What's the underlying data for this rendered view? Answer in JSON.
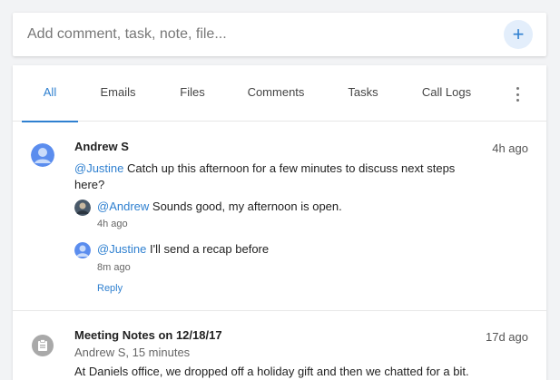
{
  "composer": {
    "placeholder": "Add comment, task, note, file...",
    "add_label": "+"
  },
  "tabs": [
    {
      "label": "All",
      "active": true
    },
    {
      "label": "Emails"
    },
    {
      "label": "Files"
    },
    {
      "label": "Comments"
    },
    {
      "label": "Tasks"
    },
    {
      "label": "Call Logs"
    }
  ],
  "colors": {
    "accent": "#2f80d0",
    "avatar": "#5b8dee",
    "note_icon": "#a9a9a9"
  },
  "feed": {
    "comment": {
      "author": "Andrew S",
      "time": "4h ago",
      "mention": "@Justine",
      "text_line1": " Catch up this afternoon for a few minutes to discuss next steps",
      "text_line2": "here?",
      "replies": [
        {
          "mention": "@Andrew",
          "text": " Sounds good, my afternoon is open.",
          "time": "4h ago"
        },
        {
          "mention": "@Justine",
          "text": " I'll send a recap before",
          "time": "8m ago"
        }
      ],
      "reply_label": "Reply"
    },
    "note": {
      "title": "Meeting Notes on 12/18/17",
      "time": "17d ago",
      "subtitle": "Andrew S, 15 minutes",
      "body": "At Daniels office, we dropped off a holiday gift and then we chatted for a bit."
    }
  }
}
